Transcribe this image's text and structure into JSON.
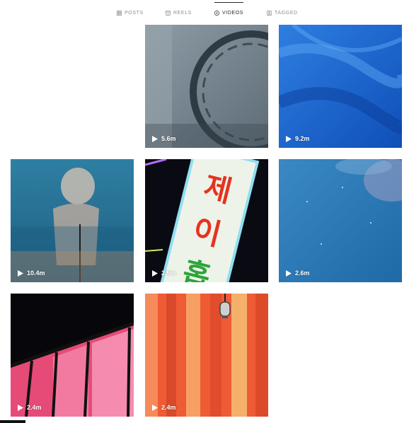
{
  "tabs": [
    {
      "label": "POSTS",
      "icon": "grid-icon",
      "active": false
    },
    {
      "label": "REELS",
      "icon": "reels-icon",
      "active": false
    },
    {
      "label": "VIDEOS",
      "icon": "video-icon",
      "active": true
    },
    {
      "label": "TAGGED",
      "icon": "tag-icon",
      "active": false
    }
  ],
  "videos": [
    {
      "views": "5.6m",
      "theme": "gray-clock"
    },
    {
      "views": "9.2m",
      "theme": "blue-water"
    },
    {
      "views": "10.4m",
      "theme": "bust-statue"
    },
    {
      "views": "2.5m",
      "theme": "neon-sign"
    },
    {
      "views": "2.6m",
      "theme": "blue-sky"
    },
    {
      "views": "2.4m",
      "theme": "pink-window"
    },
    {
      "views": "2.4m",
      "theme": "orange-curtain"
    }
  ],
  "colors": {
    "active_tab": "#262626",
    "inactive_tab": "#8e8e8e"
  }
}
